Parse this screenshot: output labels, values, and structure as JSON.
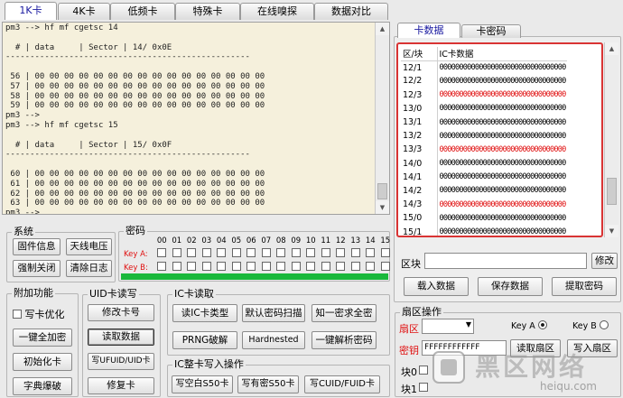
{
  "top_tabs": [
    "1K卡",
    "4K卡",
    "低频卡",
    "特殊卡",
    "在线嗅探",
    "数据对比"
  ],
  "terminal_lines": [
    "pm3 --> hf mf cgetsc 14",
    "",
    "  # | data     | Sector | 14/ 0x0E",
    "--------------------------------------------------",
    "",
    " 56 | 00 00 00 00 00 00 00 00 00 00 00 00 00 00 00 00",
    " 57 | 00 00 00 00 00 00 00 00 00 00 00 00 00 00 00 00",
    " 58 | 00 00 00 00 00 00 00 00 00 00 00 00 00 00 00 00",
    " 59 | 00 00 00 00 00 00 00 00 00 00 00 00 00 00 00 00",
    "pm3 -->",
    "pm3 --> hf mf cgetsc 15",
    "",
    "  # | data     | Sector | 15/ 0x0F",
    "--------------------------------------------------",
    "",
    " 60 | 00 00 00 00 00 00 00 00 00 00 00 00 00 00 00 00",
    " 61 | 00 00 00 00 00 00 00 00 00 00 00 00 00 00 00 00",
    " 62 | 00 00 00 00 00 00 00 00 00 00 00 00 00 00 00 00",
    " 63 | 00 00 00 00 00 00 00 00 00 00 00 00 00 00 00 00",
    "pm3 -->"
  ],
  "system": {
    "title": "系统",
    "buttons": [
      "固件信息",
      "天线电压",
      "强制关闭",
      "清除日志"
    ]
  },
  "password": {
    "title": "密码",
    "columns": [
      "00",
      "01",
      "02",
      "03",
      "04",
      "05",
      "06",
      "07",
      "08",
      "09",
      "10",
      "11",
      "12",
      "13",
      "14",
      "15"
    ],
    "key_a": "Key A:",
    "key_b": "Key B:"
  },
  "addon": {
    "title": "附加功能",
    "checkbox": "写卡优化",
    "buttons": [
      "一键全加密",
      "初始化卡",
      "字典爆破"
    ]
  },
  "uid": {
    "title": "UID卡读写",
    "buttons": [
      "修改卡号",
      "读取数据",
      "写UFUID/UID卡",
      "修复卡"
    ]
  },
  "ic_read": {
    "title": "IC卡读取",
    "buttons": [
      "读IC卡类型",
      "默认密码扫描",
      "知一密求全密",
      "PRNG破解",
      "Hardnested",
      "一键解析密码"
    ]
  },
  "ic_write": {
    "title": "IC整卡写入操作",
    "buttons": [
      "写空白S50卡",
      "写有密S50卡",
      "写CUID/FUID卡"
    ]
  },
  "right_tabs": [
    "卡数据",
    "卡密码"
  ],
  "card_table": {
    "headers": [
      "区/块",
      "IC卡数据"
    ],
    "rows": [
      {
        "blk": "12/1",
        "data": "00000000000000000000000000000000",
        "red": false
      },
      {
        "blk": "12/2",
        "data": "00000000000000000000000000000000",
        "red": false
      },
      {
        "blk": "12/3",
        "data": "00000000000000000000000000000000",
        "red": true
      },
      {
        "blk": "13/0",
        "data": "00000000000000000000000000000000",
        "red": false
      },
      {
        "blk": "13/1",
        "data": "00000000000000000000000000000000",
        "red": false
      },
      {
        "blk": "13/2",
        "data": "00000000000000000000000000000000",
        "red": false
      },
      {
        "blk": "13/3",
        "data": "00000000000000000000000000000000",
        "red": true
      },
      {
        "blk": "14/0",
        "data": "00000000000000000000000000000000",
        "red": false
      },
      {
        "blk": "14/1",
        "data": "00000000000000000000000000000000",
        "red": false
      },
      {
        "blk": "14/2",
        "data": "00000000000000000000000000000000",
        "red": false
      },
      {
        "blk": "14/3",
        "data": "00000000000000000000000000000000",
        "red": true
      },
      {
        "blk": "15/0",
        "data": "00000000000000000000000000000000",
        "red": false
      },
      {
        "blk": "15/1",
        "data": "00000000000000000000000000000000",
        "red": false
      }
    ]
  },
  "block": {
    "label": "区块",
    "value": "",
    "modify": "修改"
  },
  "actions": [
    "载入数据",
    "保存数据",
    "提取密码"
  ],
  "sector_ops": {
    "title": "扇区操作",
    "sector_label": "扇区",
    "key_a": "Key A",
    "key_b": "Key B",
    "key_label": "密钥",
    "key_value": "FFFFFFFFFFFF",
    "read_btn": "读取扇区",
    "write_btn": "写入扇区",
    "block0": "块0",
    "block1": "块1"
  },
  "watermark": {
    "text": "黑区网络",
    "url": "heiqu.com"
  },
  "colors": {
    "tab_active": "#1a1aa0",
    "keyred": "#e01010",
    "highlight": "#d93434",
    "progress": "#19b83b"
  }
}
